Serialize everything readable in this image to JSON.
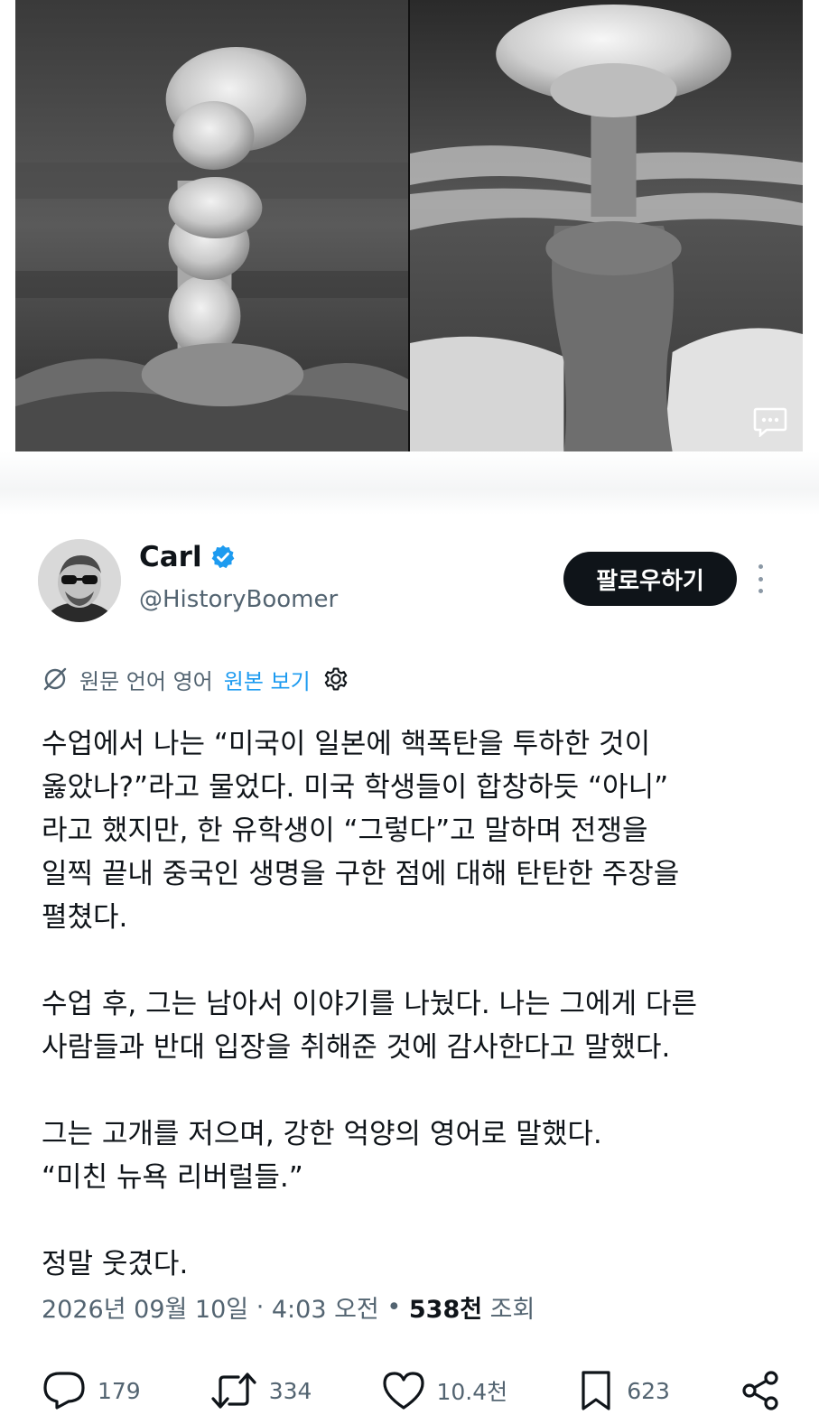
{
  "media": {
    "photos": [
      {
        "icon": "mushroom-cloud-photo"
      },
      {
        "icon": "mushroom-cloud-photo"
      }
    ],
    "alt_icon": "message-dots-icon"
  },
  "author": {
    "name": "Carl",
    "verified_icon": "verified-badge-icon",
    "handle": "@HistoryBoomer",
    "follow_label": "팔로우하기",
    "more_icon": "more-vertical-icon"
  },
  "translation": {
    "icon": "translate-icon",
    "source_text": "원문 언어 영어",
    "view_original": "원본 보기",
    "settings_icon": "gear-icon"
  },
  "tweet": {
    "paragraphs": [
      "수업에서 나는 “미국이 일본에 핵폭탄을 투하한 것이\n옳았나?”라고 물었다. 미국 학생들이 합창하듯 “아니”\n라고 했지만, 한 유학생이 “그렇다”고 말하며 전쟁을\n일찍 끝내 중국인 생명을 구한 점에 대해 탄탄한 주장을\n펼쳤다.",
      "수업 후, 그는 남아서 이야기를 나눴다. 나는 그에게 다른\n사람들과 반대 입장을 취해준 것에 감사한다고 말했다.",
      "그는 고개를 저으며, 강한 억양의 영어로 말했다.\n“미친 뉴욕 리버럴들.”",
      "정말 웃겼다."
    ]
  },
  "meta": {
    "date": "2026년 09월 10일",
    "separator": " · ",
    "time": "4:03 오전",
    "views_sep": " • ",
    "views_count": "538천",
    "views_label": " 조회"
  },
  "actions": {
    "reply": {
      "icon": "reply-icon",
      "count": "179"
    },
    "retweet": {
      "icon": "retweet-icon",
      "count": "334"
    },
    "like": {
      "icon": "heart-icon",
      "count": "10.4천"
    },
    "bookmark": {
      "icon": "bookmark-icon",
      "count": "623"
    },
    "share": {
      "icon": "share-icon"
    }
  },
  "colors": {
    "accent": "#1d9bf0",
    "text": "#0f1419",
    "secondary": "#536471",
    "button": "#0f1419"
  }
}
